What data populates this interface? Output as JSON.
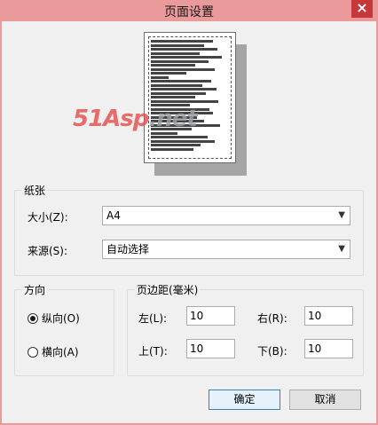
{
  "window": {
    "title": "页面设置",
    "close_label": "×"
  },
  "preview": {
    "watermark_main": "51Asp",
    "watermark_tail": ".net"
  },
  "paper": {
    "group_title": "纸张",
    "size_label": "大小(Z):",
    "size_value": "A4",
    "source_label": "来源(S):",
    "source_value": "自动选择"
  },
  "orientation": {
    "group_title": "方向",
    "portrait_label": "纵向(O)",
    "landscape_label": "横向(A)",
    "selected": "portrait"
  },
  "margins": {
    "group_title": "页边距(毫米)",
    "left_label": "左(L):",
    "left_value": "10",
    "right_label": "右(R):",
    "right_value": "10",
    "top_label": "上(T):",
    "top_value": "10",
    "bottom_label": "下(B):",
    "bottom_value": "10"
  },
  "buttons": {
    "ok": "确定",
    "cancel": "取消"
  }
}
